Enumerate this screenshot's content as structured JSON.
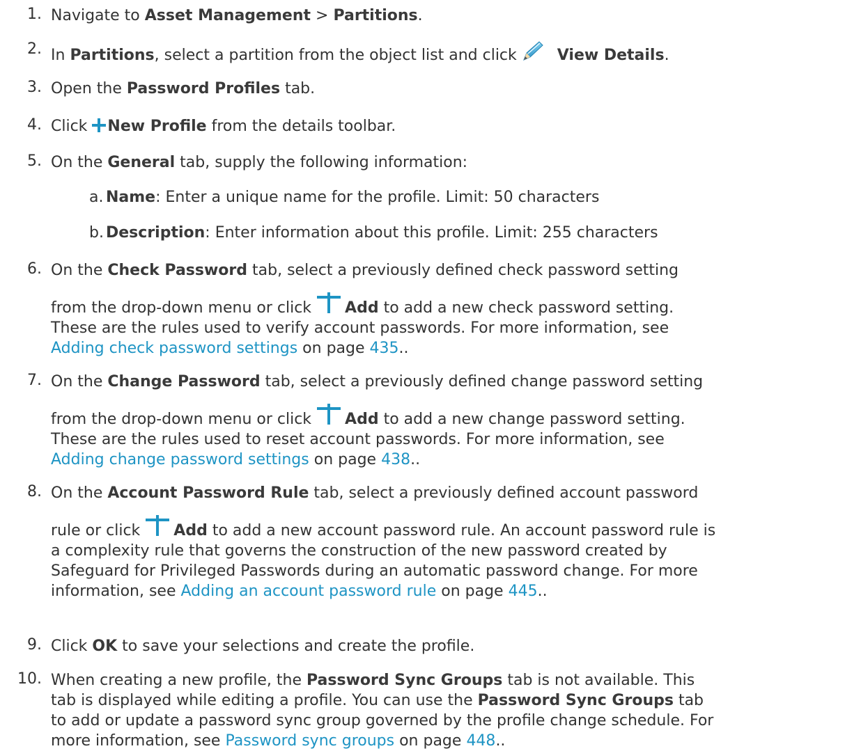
{
  "steps": [
    {
      "num": "1.",
      "t1": "Navigate to ",
      "b1": "Asset Management",
      "t2": " > ",
      "b2": "Partitions",
      "t3": "."
    },
    {
      "num": "2.",
      "t1": "In ",
      "b1": "Partitions",
      "t2": ", select a partition from the object list and click",
      "b2": "View Details",
      "t3": ".",
      "icon": "pencil-icon"
    },
    {
      "num": "3.",
      "t1": "Open the ",
      "b1": "Password Profiles",
      "t2": " tab."
    },
    {
      "num": "4.",
      "t1": "Click ",
      "b1": "New Profile",
      "t2": " from the details toolbar.",
      "icon": "plus-icon"
    },
    {
      "num": "5.",
      "t1": "On the ",
      "b1": "General",
      "t2": " tab, supply the following information:"
    },
    {
      "num": "6.",
      "l1a": "On the ",
      "l1b": "Check Password",
      "l1c": " tab, select a previously defined check password setting",
      "l2a": "from the drop-down menu or click",
      "l2b": "Add",
      "l2c": " to add a new check password setting.",
      "l3": "These are the rules used to verify account passwords. For more information, see",
      "link": "Adding check password settings",
      "l4a": " on page ",
      "page": "435",
      "l4b": "..",
      "icon": "plus-icon"
    },
    {
      "num": "7.",
      "l1a": "On the ",
      "l1b": "Change Password",
      "l1c": " tab, select a previously defined change password setting",
      "l2a": "from the drop-down menu or click",
      "l2b": "Add",
      "l2c": " to add a new change password setting.",
      "l3": "These are the rules used to reset account passwords. For more information, see",
      "link": "Adding change password settings",
      "l4a": " on page ",
      "page": "438",
      "l4b": "..",
      "icon": "plus-icon"
    },
    {
      "num": "8.",
      "l1a": "On the ",
      "l1b": "Account Password Rule",
      "l1c": " tab, select a previously defined account password",
      "l2a": "rule or click",
      "l2b": "Add",
      "l2c": " to add a new account password rule. An account password rule is",
      "l3": "a complexity rule that governs the construction of the new password created by",
      "l3b": "Safeguard for Privileged Passwords during an automatic password change. For more",
      "l4pre": "information, see ",
      "link": "Adding an account password rule",
      "l4a": " on page ",
      "page": "445",
      "l4b": "..",
      "icon": "plus-icon"
    },
    {
      "num": "9.",
      "t1": "Click ",
      "b1": "OK",
      "t2": " to save your selections and create the profile."
    },
    {
      "num": "10.",
      "l1a": "When creating a new profile, the ",
      "l1b": "Password Sync Groups",
      "l1c": " tab is not available. This",
      "l2": "tab is displayed while editing a profile. You can use the ",
      "l2b": "Password Sync Groups",
      "l2c": " tab",
      "l3": "to add or update a password sync group governed by the profile change schedule. For",
      "l4pre": "more information, see ",
      "link": "Password sync groups",
      "l4a": " on page ",
      "page": "448",
      "l4b": ".."
    }
  ],
  "substeps": [
    {
      "letter": "a.",
      "b": "Name",
      "t": ": Enter a unique name for the profile. Limit: 50 characters"
    },
    {
      "letter": "b.",
      "b": "Description",
      "t": ": Enter information about this profile. Limit: 255 characters"
    }
  ],
  "colors": {
    "text": "#333333",
    "link": "#1e94c4"
  }
}
